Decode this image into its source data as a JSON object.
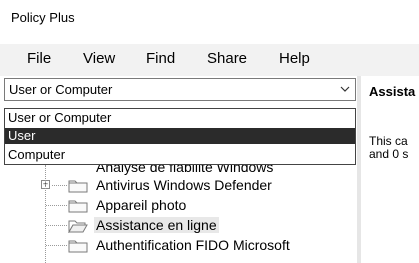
{
  "window": {
    "title": "Policy Plus"
  },
  "menu": [
    "File",
    "View",
    "Find",
    "Share",
    "Help"
  ],
  "context_combo": {
    "selected": "User or Computer",
    "options": [
      "User or Computer",
      "User",
      "Computer"
    ],
    "highlighted_option": "User"
  },
  "tree": {
    "partial_row": "Analyse de fiabilité Windows",
    "items": [
      {
        "label": "Antivirus Windows Defender",
        "icon": "folder-icon",
        "expandable": true
      },
      {
        "label": "Appareil photo",
        "icon": "folder-icon",
        "expandable": false
      },
      {
        "label": "Assistance en ligne",
        "icon": "folder-open-icon",
        "expandable": false,
        "selected": true
      },
      {
        "label": "Authentification FIDO Microsoft",
        "icon": "folder-icon",
        "expandable": false
      }
    ]
  },
  "detail": {
    "heading": "Assista",
    "line1": "This ca",
    "line2": "and 0 s"
  },
  "colors": {
    "menubar_bg": "#f2f2f2",
    "selected_option_bg": "#2b2b2b",
    "selected_option_fg": "#ffffff"
  }
}
